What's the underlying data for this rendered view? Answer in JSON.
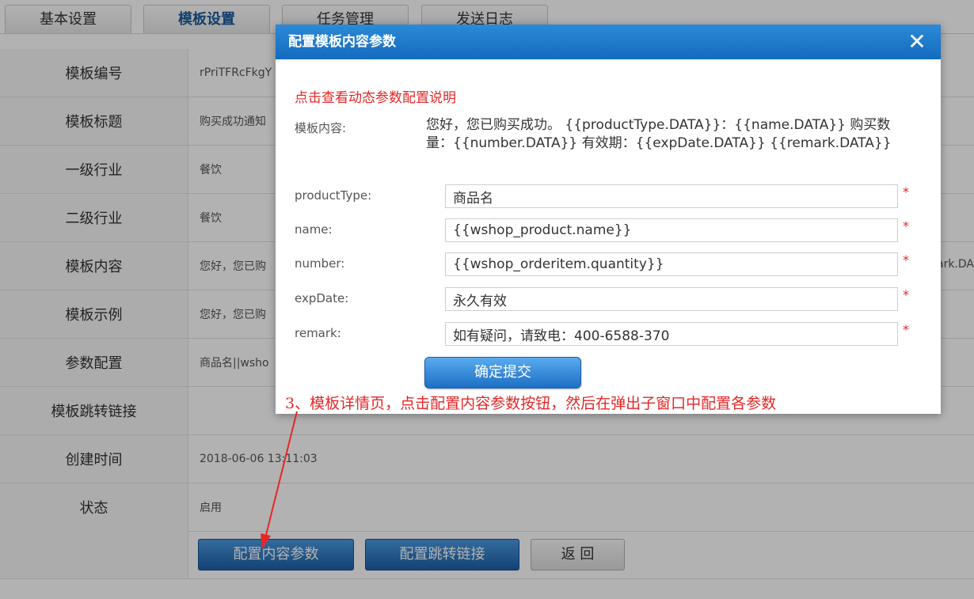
{
  "tabs": [
    {
      "label": "基本设置"
    },
    {
      "label": "模板设置"
    },
    {
      "label": "任务管理"
    },
    {
      "label": "发送日志"
    }
  ],
  "details": [
    {
      "label": "模板编号",
      "value": "rPriTFRcFkgY"
    },
    {
      "label": "模板标题",
      "value": "购买成功通知"
    },
    {
      "label": "一级行业",
      "value": "餐饮"
    },
    {
      "label": "二级行业",
      "value": "餐饮"
    },
    {
      "label": "模板内容",
      "value": "您好，您已购",
      "value_right": "ark.DA"
    },
    {
      "label": "模板示例",
      "value": "您好，您已购"
    },
    {
      "label": "参数配置",
      "value": "商品名||wsho"
    },
    {
      "label": "模板跳转链接",
      "value": ""
    },
    {
      "label": "创建时间",
      "value": "2018-06-06 13:11:03"
    },
    {
      "label": "状态",
      "value": "启用"
    }
  ],
  "actions": {
    "config_params": "配置内容参数",
    "config_link": "配置跳转链接",
    "back": "返 回"
  },
  "modal": {
    "title": "配置模板内容参数",
    "close": "✕",
    "help_link": "点击查看动态参数配置说明",
    "content_label": "模板内容:",
    "content_text": "您好，您已购买成功。 {{productType.DATA}}：{{name.DATA}} 购买数量：{{number.DATA}} 有效期：{{expDate.DATA}} {{remark.DATA}}",
    "fields": [
      {
        "label": "productType:",
        "value": "商品名"
      },
      {
        "label": "name:",
        "value": "{{wshop_product.name}}"
      },
      {
        "label": "number:",
        "value": "{{wshop_orderitem.quantity}}"
      },
      {
        "label": "expDate:",
        "value": "永久有效"
      },
      {
        "label": "remark:",
        "value": "如有疑问，请致电：400-6588-370"
      }
    ],
    "required_mark": "*",
    "submit": "确定提交"
  },
  "annotation": "3、模板详情页，点击配置内容参数按钮，然后在弹出子窗口中配置各参数",
  "colors": {
    "primary": "#1e6fbd",
    "header": "#1f7ccc",
    "required": "#e52727"
  }
}
